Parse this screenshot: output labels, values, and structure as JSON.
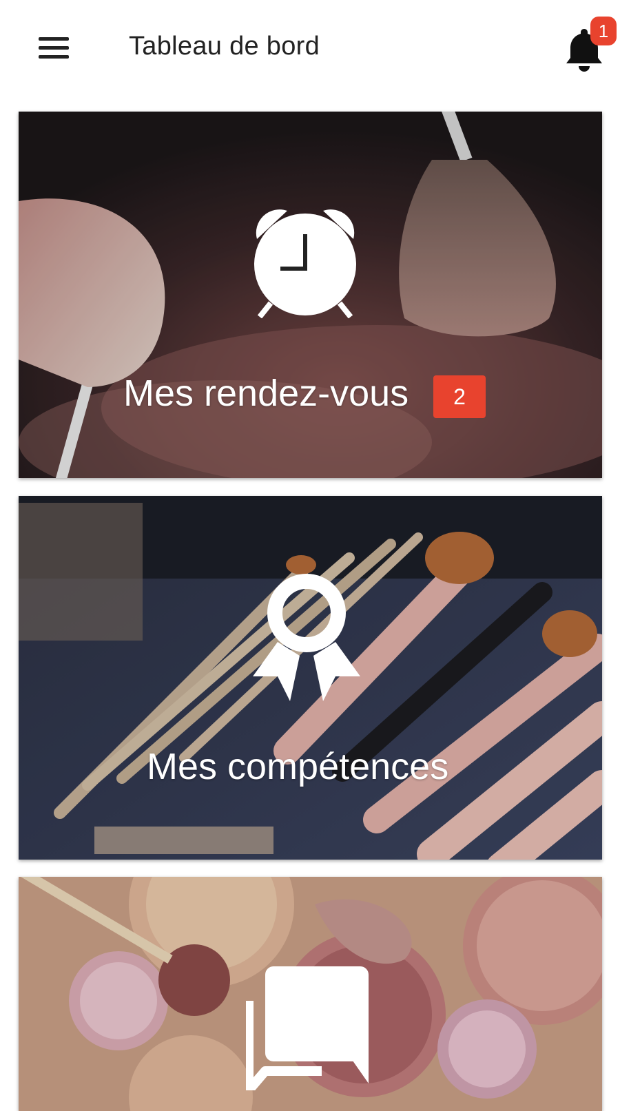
{
  "appbar": {
    "title": "Tableau de bord",
    "menu_icon": "hamburger-menu-icon",
    "notifications_icon": "bell-icon",
    "notifications_count": "1"
  },
  "cards": [
    {
      "label": "Mes rendez-vous",
      "icon": "alarm-clock-icon",
      "badge": "2",
      "background": "makeup brushes with pink powder on dark background"
    },
    {
      "label": "Mes compétences",
      "icon": "award-ribbon-icon",
      "background": "makeup brush set on denim cloth"
    },
    {
      "label": "",
      "icon": "chat-messages-icon",
      "background": "loose powder pots on wooden table"
    }
  ],
  "colors": {
    "accent": "#e8432e",
    "appbar_bg": "#ffffff",
    "text": "#222222"
  }
}
